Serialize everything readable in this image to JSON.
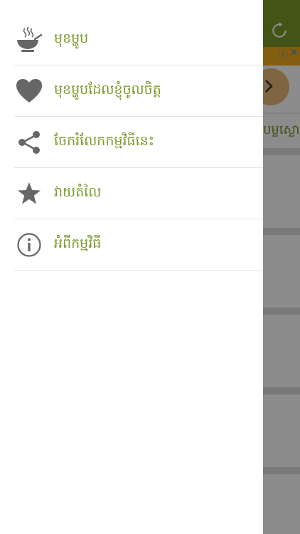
{
  "colors": {
    "accent": "#7a9a2a",
    "icon": "#666666",
    "ad_strip": "#f1a91c"
  },
  "background": {
    "card_title": "បម្លស្ងោ"
  },
  "drawer": {
    "items": [
      {
        "label": "មុខម្ហូប",
        "icon": "food-bowl-icon"
      },
      {
        "label": "មុខម្ហូបដែលខ្ញុំចូលចិត្ត",
        "icon": "heart-icon"
      },
      {
        "label": "ចែករំលែកកម្មវិធីនេះ",
        "icon": "share-icon"
      },
      {
        "label": "វាយតំលៃ",
        "icon": "star-icon"
      },
      {
        "label": "អំពីកម្មវិធី",
        "icon": "info-icon"
      }
    ]
  }
}
